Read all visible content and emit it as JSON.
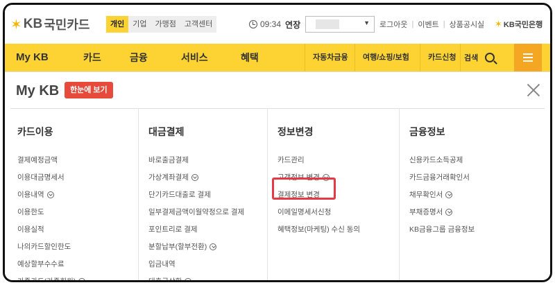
{
  "header": {
    "brand": "KB",
    "brand_name": "국민카드",
    "segments": [
      "개인",
      "기업",
      "가맹점",
      "고객센터"
    ],
    "active_segment": "개인",
    "session_time": "09:34",
    "extend_label": "연장",
    "utility_links": [
      "로그아웃",
      "이벤트",
      "상품공시실"
    ],
    "bank_link": "KB국민은행"
  },
  "nav": {
    "home": "My KB",
    "items": [
      "카드",
      "금융",
      "서비스",
      "혜택"
    ],
    "sub_items": [
      "자동차금융",
      "여행/쇼핑/보험",
      "카드신청"
    ],
    "search_label": "검색"
  },
  "panel": {
    "title": "My KB",
    "overview_button": "한눈에 보기",
    "columns": [
      {
        "heading": "카드이용",
        "items": [
          {
            "label": "결제예정금액",
            "chevron": false
          },
          {
            "label": "이용대금명세서",
            "chevron": false
          },
          {
            "label": "이용내역",
            "chevron": true
          },
          {
            "label": "이용한도",
            "chevron": false
          },
          {
            "label": "이용실적",
            "chevron": false
          },
          {
            "label": "나의카드할인한도",
            "chevron": false
          },
          {
            "label": "예상할부수수료",
            "chevron": false
          },
          {
            "label": "가족카드(가족회원)",
            "chevron": true
          }
        ]
      },
      {
        "heading": "대금결제",
        "items": [
          {
            "label": "바로출금결제",
            "chevron": false
          },
          {
            "label": "가상계좌결제",
            "chevron": true
          },
          {
            "label": "단기카드대출로 결제",
            "chevron": false
          },
          {
            "label": "일부결제금액이월약정으로 결제",
            "chevron": false
          },
          {
            "label": "포인트리로 결제",
            "chevron": false
          },
          {
            "label": "분할납부(할부전환)",
            "chevron": true
          },
          {
            "label": "입금내역",
            "chevron": false
          },
          {
            "label": "대출금상환",
            "chevron": true
          }
        ]
      },
      {
        "heading": "정보변경",
        "items": [
          {
            "label": "카드관리",
            "chevron": false
          },
          {
            "label": "고객정보 변경",
            "chevron": true
          },
          {
            "label": "결제정보 변경",
            "chevron": false
          },
          {
            "label": "이메일명세서신청",
            "chevron": false
          },
          {
            "label": "혜택정보(마케팅) 수신 동의",
            "chevron": false
          }
        ]
      },
      {
        "heading": "금융정보",
        "items": [
          {
            "label": "신용카드소득공제",
            "chevron": false
          },
          {
            "label": "카드금융거래확인서",
            "chevron": false
          },
          {
            "label": "채무확인서",
            "chevron": true
          },
          {
            "label": "부채증명서",
            "chevron": true
          },
          {
            "label": "KB금융그룹 금융정보",
            "chevron": false
          }
        ]
      }
    ]
  },
  "colors": {
    "nav_yellow": "#fcd333",
    "menu_orange": "#f5a623",
    "overview_red": "#e64a3b",
    "highlight_red": "#e63946"
  }
}
